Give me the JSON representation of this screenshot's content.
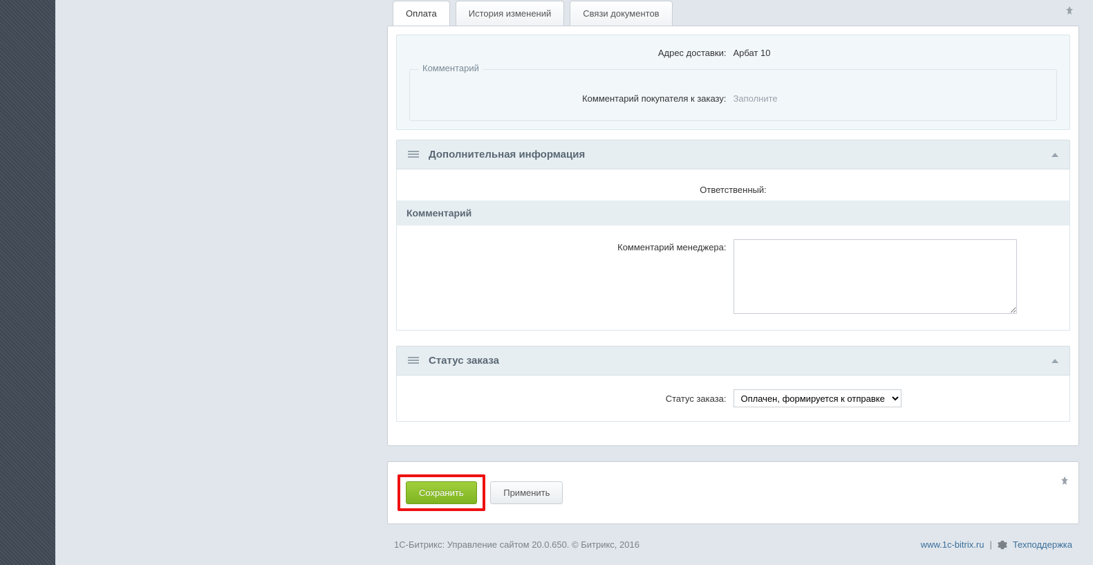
{
  "tabs": {
    "payment": "Оплата",
    "history": "История изменений",
    "docs": "Связи документов"
  },
  "delivery": {
    "address_label": "Адрес доставки:",
    "address_value": "Арбат 10"
  },
  "comment_group": {
    "legend": "Комментарий",
    "buyer_label": "Комментарий покупателя к заказу:",
    "buyer_placeholder": "Заполните"
  },
  "extra_info": {
    "title": "Дополнительная информация",
    "responsible_label": "Ответственный:",
    "comment_heading": "Комментарий",
    "manager_comment_label": "Комментарий менеджера:"
  },
  "order_status": {
    "title": "Статус заказа",
    "label": "Статус заказа:",
    "selected": "Оплачен, формируется к отправке"
  },
  "buttons": {
    "save": "Сохранить",
    "apply": "Применить"
  },
  "footer": {
    "copyright": "1С-Битрикс: Управление сайтом 20.0.650. © Битрикс, 2016",
    "site": "www.1c-bitrix.ru",
    "divider": "|",
    "support": "Техподдержка"
  }
}
